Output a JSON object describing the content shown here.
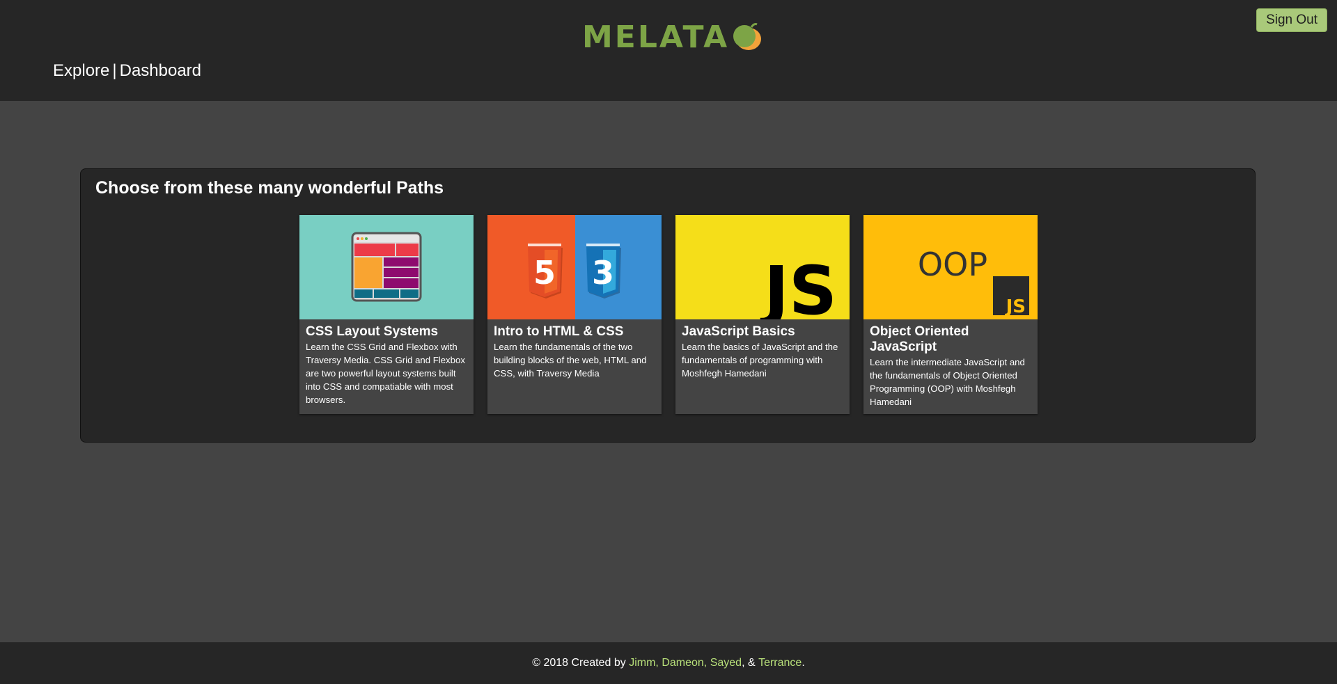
{
  "header": {
    "logo_text": "MELATA",
    "nav": {
      "explore": "Explore",
      "separator": "|",
      "dashboard": "Dashboard"
    },
    "signout_label": "Sign Out"
  },
  "panel": {
    "title": "Choose from these many wonderful Paths",
    "cards": [
      {
        "title": "CSS Layout Systems",
        "description": "Learn the CSS Grid and Flexbox with Traversy Media. CSS Grid and Flexbox are two powerful layout systems built into CSS and compatiable with most browsers.",
        "image_bg": "#79cfc3"
      },
      {
        "title": "Intro to HTML & CSS",
        "description": "Learn the fundamentals of the two building blocks of the web, HTML and CSS, with Traversy Media",
        "image_bg_left": "#f05a28",
        "image_bg_right": "#3a8fd4",
        "badge_left": "5",
        "badge_right": "3"
      },
      {
        "title": "JavaScript Basics",
        "description": "Learn the basics of JavaScript and the fundamentals of programming with Moshfegh Hamedani",
        "image_bg": "#f5de19",
        "image_text": "JS"
      },
      {
        "title": "Object Oriented JavaScript",
        "description": "Learn the intermediate JavaScript and the fundamentals of Object Oriented Programming (OOP) with Moshfegh Hamedani",
        "image_bg": "#ffbd0a",
        "image_text": "OOP",
        "image_badge": "JS"
      }
    ]
  },
  "footer": {
    "prefix": "© 2018 Created by ",
    "authors": [
      "Jimm",
      "Dameon",
      "Sayed",
      "Terrance"
    ],
    "sep_comma": ", ",
    "sep_and": ", & ",
    "suffix": "."
  },
  "colors": {
    "brand_green": "#7da446",
    "author_link": "#b8e07a",
    "signout_bg": "#a9c97a"
  }
}
